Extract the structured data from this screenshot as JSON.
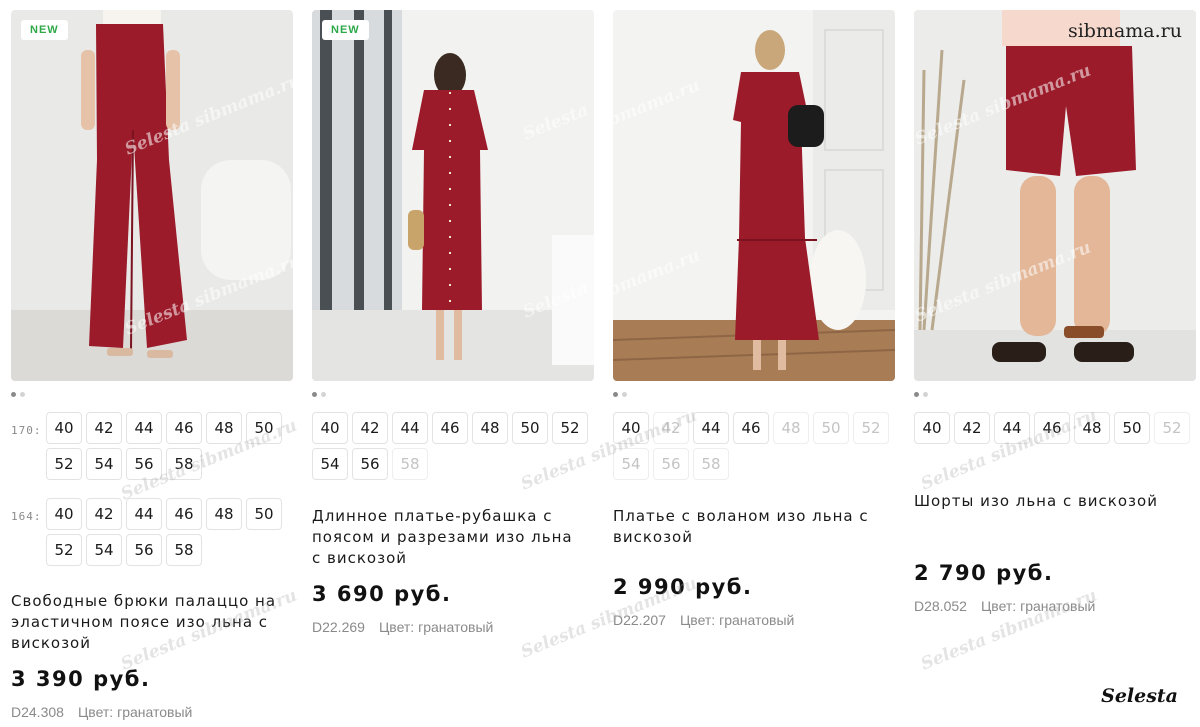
{
  "products": [
    {
      "badge": "NEW",
      "image_alt": "Wide red palazzo trousers",
      "title": "Свободные брюки палаццо на эластичном поясе изо льна с вискозой",
      "price": "3 390 руб.",
      "sku": "D24.308",
      "color": "Цвет: гранатовый",
      "size_groups": [
        {
          "label": "170:",
          "sizes": [
            {
              "v": "40"
            },
            {
              "v": "42"
            },
            {
              "v": "44"
            },
            {
              "v": "46"
            },
            {
              "v": "48"
            },
            {
              "v": "50"
            },
            {
              "v": "52"
            },
            {
              "v": "54"
            },
            {
              "v": "56"
            },
            {
              "v": "58"
            }
          ]
        },
        {
          "label": "164:",
          "sizes": [
            {
              "v": "40"
            },
            {
              "v": "42"
            },
            {
              "v": "44"
            },
            {
              "v": "46"
            },
            {
              "v": "48"
            },
            {
              "v": "50"
            },
            {
              "v": "52"
            },
            {
              "v": "54"
            },
            {
              "v": "56"
            },
            {
              "v": "58"
            }
          ]
        }
      ]
    },
    {
      "badge": "NEW",
      "image_alt": "Long red shirt dress",
      "title": "Длинное платье-рубашка с поясом и разрезами изо льна с вискозой",
      "price": "3 690 руб.",
      "sku": "D22.269",
      "color": "Цвет: гранатовый",
      "size_groups": [
        {
          "label": "",
          "sizes": [
            {
              "v": "40"
            },
            {
              "v": "42"
            },
            {
              "v": "44"
            },
            {
              "v": "46"
            },
            {
              "v": "48"
            },
            {
              "v": "50"
            },
            {
              "v": "52"
            },
            {
              "v": "54"
            },
            {
              "v": "56"
            },
            {
              "v": "58",
              "na": true
            }
          ]
        }
      ]
    },
    {
      "badge": "",
      "image_alt": "Red dress with flounce",
      "title": "Платье с воланом изо льна с вискозой",
      "price": "2 990 руб.",
      "sku": "D22.207",
      "color": "Цвет: гранатовый",
      "size_groups": [
        {
          "label": "",
          "sizes": [
            {
              "v": "40"
            },
            {
              "v": "42",
              "na": true
            },
            {
              "v": "44"
            },
            {
              "v": "46"
            },
            {
              "v": "48",
              "na": true
            },
            {
              "v": "50",
              "na": true
            },
            {
              "v": "52",
              "na": true
            },
            {
              "v": "54",
              "na": true
            },
            {
              "v": "56",
              "na": true
            },
            {
              "v": "58",
              "na": true
            }
          ]
        }
      ]
    },
    {
      "badge": "",
      "image_alt": "Red linen shorts",
      "title": "Шорты изо льна с вискозой",
      "price": "2 790 руб.",
      "sku": "D28.052",
      "color": "Цвет: гранатовый",
      "size_groups": [
        {
          "label": "",
          "sizes": [
            {
              "v": "40"
            },
            {
              "v": "42"
            },
            {
              "v": "44"
            },
            {
              "v": "46"
            },
            {
              "v": "48"
            },
            {
              "v": "50"
            },
            {
              "v": "52",
              "na": true
            }
          ]
        }
      ]
    }
  ],
  "watermark": "Selesta sibmama.ru",
  "brand_site": "sibmama.ru",
  "brand_signature": "Selesta",
  "colors": {
    "garnet": "#9b1b2a",
    "available_text": "#1a1a1a",
    "unavailable_text": "#c4c4c4",
    "new_badge": "#2fa84a"
  }
}
